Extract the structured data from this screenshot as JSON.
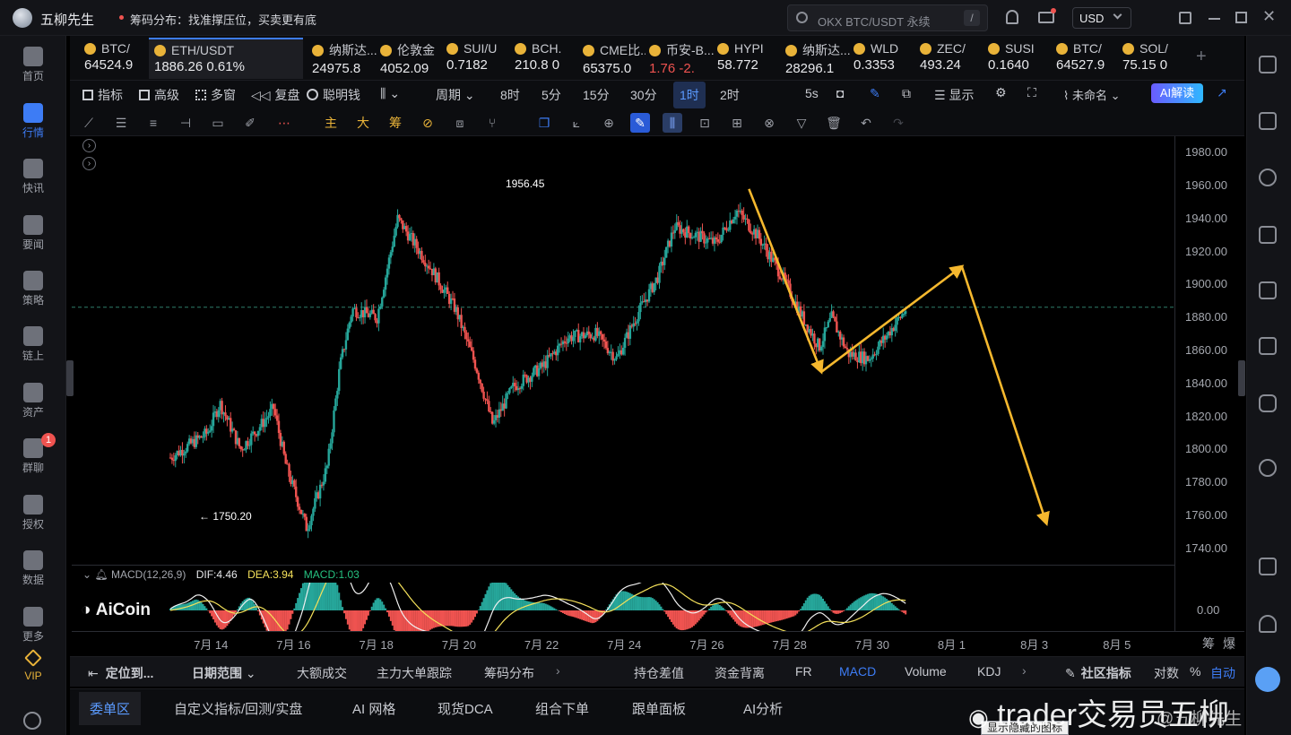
{
  "app": {
    "name": "五柳先生"
  },
  "titlebar": {
    "notice": "筹码分布：找准撑压位，买卖更有底",
    "search_placeholder": "OKX BTC/USDT 永续",
    "search_shortcut": "/",
    "currency": "USD"
  },
  "leftnav": [
    {
      "label": "首页",
      "icon": "home-icon"
    },
    {
      "label": "行情",
      "icon": "chart-bars-icon",
      "active": true
    },
    {
      "label": "快讯",
      "icon": "news-icon"
    },
    {
      "label": "要闻",
      "icon": "headline-icon"
    },
    {
      "label": "策略",
      "icon": "strategy-icon"
    },
    {
      "label": "链上",
      "icon": "chain-icon"
    },
    {
      "label": "资产",
      "icon": "wallet-icon"
    },
    {
      "label": "群聊",
      "icon": "chat-icon",
      "badge": "1"
    },
    {
      "label": "授权",
      "icon": "key-icon"
    },
    {
      "label": "数据",
      "icon": "data-icon"
    },
    {
      "label": "更多",
      "icon": "more-icon"
    },
    {
      "label": "VIP",
      "icon": "vip-icon"
    }
  ],
  "tickers": [
    {
      "name": "BTC/",
      "price": "64524.9"
    },
    {
      "name": "ETH/USDT",
      "price": "1886.26",
      "change": "0.61%",
      "active": true
    },
    {
      "name": "纳斯达...",
      "price": "24975.8"
    },
    {
      "name": "伦敦金",
      "price": "4052.09"
    },
    {
      "name": "SUI/U",
      "price": "0.7182"
    },
    {
      "name": "BCH.",
      "price": "210.8",
      "change": "0"
    },
    {
      "name": "CME比...",
      "price": "65375.0"
    },
    {
      "name": "币安-B...",
      "price": "1.76",
      "change": "-2."
    },
    {
      "name": "HYPI",
      "price": "58.772"
    },
    {
      "name": "纳斯达...",
      "price": "28296.1"
    },
    {
      "name": "WLD",
      "price": "0.3353"
    },
    {
      "name": "ZEC/",
      "price": "493.24"
    },
    {
      "name": "SUSI",
      "price": "0.1640"
    },
    {
      "name": "BTC/",
      "price": "64527.9"
    },
    {
      "name": "SOL/",
      "price": "75.15",
      "change": "0"
    }
  ],
  "toolbar": {
    "indicator": "指标",
    "advanced": "高级",
    "multi_window": "多窗",
    "replay": "复盘",
    "smart_money": "聪明钱",
    "period": "周期",
    "intervals": [
      "8时",
      "5分",
      "15分",
      "30分",
      "1时",
      "2时"
    ],
    "active_interval": "1时",
    "refresh": "5s",
    "display": "显示",
    "unnamed": "未命名",
    "ai_read": "AI解读"
  },
  "drawbar": {
    "tags": [
      "主",
      "大",
      "筹"
    ]
  },
  "chart": {
    "high_label": "1956.45",
    "low_label": "1750.20",
    "current_price": 1886.26,
    "colors": {
      "up": "#26a69a",
      "down": "#ef5350",
      "arrow": "#f5b82e",
      "dashed": "#2e7d6b"
    }
  },
  "macd": {
    "title": "MACD(12,26,9)",
    "dif": "DIF:4.46",
    "dea": "DEA:3.94",
    "macd": "MACD:1.03",
    "zero_label": "0.00"
  },
  "watermark": {
    "brand": "AiCoin",
    "overlay_text": "trader交易员五柳",
    "weibo": "@五柳先生"
  },
  "bottom_tabs": {
    "locate": "定位到...",
    "date_range": "日期范围",
    "left_items": [
      "大额成交",
      "主力大单跟踪",
      "筹码分布"
    ],
    "right_items": [
      "持仓差值",
      "资金背离",
      "FR",
      "MACD",
      "Volume",
      "KDJ"
    ],
    "active_item": "MACD",
    "community": "社区指标",
    "log": "对数",
    "percent": "%",
    "auto": "自动"
  },
  "bottom_panel": {
    "tabs": [
      "委单区",
      "自定义指标/回测/实盘",
      "AI 网格",
      "现货DCA",
      "组合下单",
      "跟单面板",
      "AI分析"
    ],
    "tooltip": "显示隐藏的图标"
  },
  "chart_data": {
    "type": "candlestick",
    "price_axis": [
      1980,
      1960,
      1940,
      1920,
      1900,
      1880,
      1860,
      1840,
      1820,
      1800,
      1780,
      1760,
      1740
    ],
    "price_tick_labels": [
      "1980.00",
      "1960.00",
      "1940.00",
      "1920.00",
      "1900.00",
      "1880.00",
      "1860.00",
      "1840.00",
      "1820.00",
      "1800.00",
      "1780.00",
      "1760.00",
      "1740.00"
    ],
    "ylim": [
      1730,
      1990
    ],
    "x_tick_labels": [
      "7月 14",
      "7月 16",
      "7月 18",
      "7月 20",
      "7月 22",
      "7月 24",
      "7月 26",
      "7月 28",
      "7月 30",
      "8月 1",
      "8月 3",
      "8月 5"
    ],
    "xlim_days": [
      "7月 13",
      "8月 6"
    ],
    "close_path": [
      {
        "t": 0.0,
        "v": 1795
      },
      {
        "t": 0.9,
        "v": 1810
      },
      {
        "t": 1.2,
        "v": 1828
      },
      {
        "t": 1.7,
        "v": 1800
      },
      {
        "t": 2.2,
        "v": 1815
      },
      {
        "t": 2.5,
        "v": 1825
      },
      {
        "t": 2.8,
        "v": 1790
      },
      {
        "t": 3.3,
        "v": 1752
      },
      {
        "t": 3.8,
        "v": 1790
      },
      {
        "t": 4.1,
        "v": 1850
      },
      {
        "t": 4.4,
        "v": 1885
      },
      {
        "t": 5.0,
        "v": 1880
      },
      {
        "t": 5.5,
        "v": 1940
      },
      {
        "t": 5.9,
        "v": 1925
      },
      {
        "t": 6.3,
        "v": 1910
      },
      {
        "t": 6.9,
        "v": 1885
      },
      {
        "t": 7.4,
        "v": 1850
      },
      {
        "t": 7.8,
        "v": 1815
      },
      {
        "t": 8.3,
        "v": 1838
      },
      {
        "t": 9.0,
        "v": 1850
      },
      {
        "t": 9.6,
        "v": 1868
      },
      {
        "t": 10.3,
        "v": 1870
      },
      {
        "t": 10.8,
        "v": 1855
      },
      {
        "t": 11.3,
        "v": 1882
      },
      {
        "t": 11.8,
        "v": 1905
      },
      {
        "t": 12.2,
        "v": 1935
      },
      {
        "t": 12.7,
        "v": 1930
      },
      {
        "t": 13.2,
        "v": 1925
      },
      {
        "t": 13.7,
        "v": 1945
      },
      {
        "t": 14.2,
        "v": 1930
      },
      {
        "t": 14.8,
        "v": 1905
      },
      {
        "t": 15.3,
        "v": 1880
      },
      {
        "t": 15.7,
        "v": 1862
      },
      {
        "t": 16.0,
        "v": 1880
      },
      {
        "t": 16.4,
        "v": 1858
      },
      {
        "t": 16.9,
        "v": 1855
      },
      {
        "t": 17.3,
        "v": 1868
      },
      {
        "t": 17.8,
        "v": 1885
      }
    ],
    "projection_arrows": [
      {
        "from": {
          "t": 14.0,
          "v": 1958
        },
        "to": {
          "t": 15.75,
          "v": 1847
        }
      },
      {
        "from": {
          "t": 15.75,
          "v": 1847
        },
        "to": {
          "t": 19.15,
          "v": 1911
        }
      },
      {
        "from": {
          "t": 19.15,
          "v": 1911
        },
        "to": {
          "t": 21.2,
          "v": 1755
        }
      }
    ],
    "annotations": [
      {
        "text": "1956.45",
        "t": 14.1,
        "v": 1956.45
      },
      {
        "text": "1750.20",
        "t": 3.25,
        "v": 1750.2
      }
    ],
    "macd_series": [
      "DIF",
      "DEA",
      "MACD"
    ],
    "grid": false
  }
}
